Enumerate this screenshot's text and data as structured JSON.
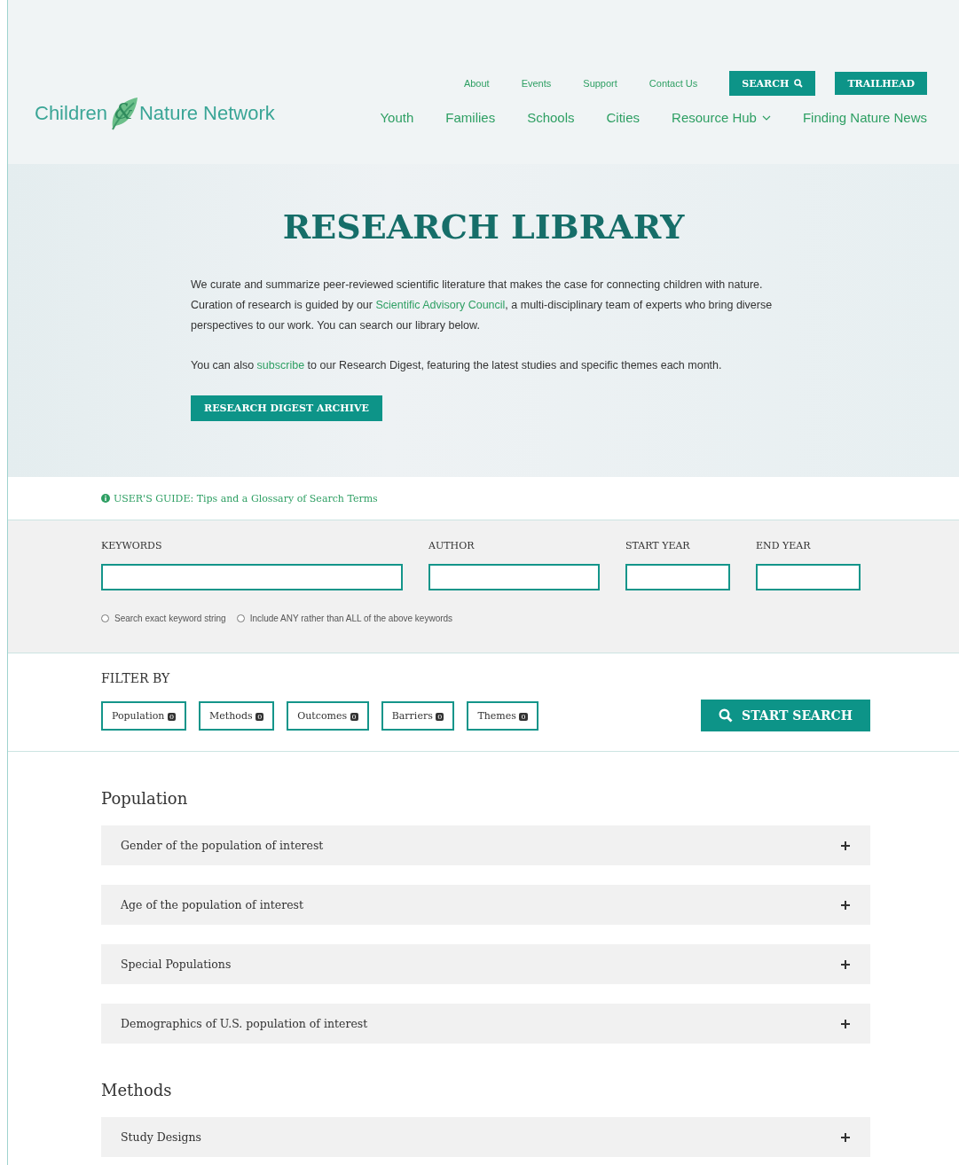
{
  "header": {
    "logo": {
      "left": "Children",
      "amp": "&",
      "right": "Nature Network"
    },
    "utility_links": [
      "About",
      "Events",
      "Support",
      "Contact Us"
    ],
    "search_button": "SEARCH",
    "trailhead_button": "TRAILHEAD",
    "main_nav": [
      {
        "label": "Youth",
        "dropdown": false
      },
      {
        "label": "Families",
        "dropdown": false
      },
      {
        "label": "Schools",
        "dropdown": false
      },
      {
        "label": "Cities",
        "dropdown": false
      },
      {
        "label": "Resource Hub",
        "dropdown": true
      },
      {
        "label": "Finding Nature News",
        "dropdown": false
      }
    ]
  },
  "hero": {
    "title": "RESEARCH LIBRARY",
    "paragraphs": [
      {
        "before": "We curate and summarize peer-reviewed scientific literature that makes the case for connecting children with nature. Curation of research is guided by our ",
        "link": "Scientific Advisory Council",
        "after": ", a multi-disciplinary team of experts who bring diverse perspectives to our work. You can search our library below."
      },
      {
        "before": "You can also ",
        "link": "subscribe",
        "after": " to our Research Digest, featuring the latest studies and specific themes each month."
      }
    ],
    "button": "RESEARCH DIGEST ARCHIVE"
  },
  "users_guide": "USER'S GUIDE: Tips and a Glossary of Search Terms",
  "search_form": {
    "fields": [
      {
        "label": "KEYWORDS"
      },
      {
        "label": "AUTHOR"
      },
      {
        "label": "START YEAR"
      },
      {
        "label": "END YEAR"
      }
    ],
    "options": [
      {
        "label": "Search exact keyword string",
        "checked": false
      },
      {
        "label": "Include ANY rather than ALL of the above keywords",
        "checked": false
      }
    ]
  },
  "filter": {
    "title": "FILTER BY",
    "chips": [
      {
        "label": "Population",
        "count": "0"
      },
      {
        "label": "Methods",
        "count": "0"
      },
      {
        "label": "Outcomes",
        "count": "0"
      },
      {
        "label": "Barriers",
        "count": "0"
      },
      {
        "label": "Themes",
        "count": "0"
      }
    ],
    "search_button": "START SEARCH"
  },
  "sections": [
    {
      "title": "Population",
      "items": [
        {
          "label": "Gender of the population of interest",
          "expanded": false
        },
        {
          "label": "Age of the population of interest",
          "expanded": false
        },
        {
          "label": "Special Populations",
          "expanded": false
        },
        {
          "label": "Demographics of U.S. population of interest",
          "expanded": false
        }
      ]
    },
    {
      "title": "Methods",
      "items": [
        {
          "label": "Study Designs",
          "expanded": false
        }
      ]
    }
  ]
}
